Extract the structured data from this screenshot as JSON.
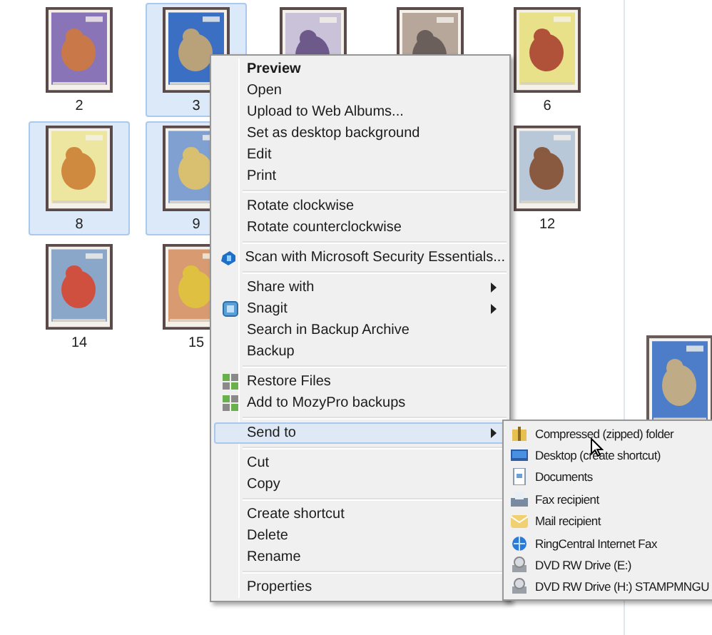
{
  "thumbnails": [
    {
      "kind": "stamp",
      "label": "2",
      "selected": false
    },
    {
      "kind": "stamp",
      "label": "3",
      "selected": true
    },
    {
      "kind": "partial"
    },
    {
      "kind": "partial"
    },
    {
      "kind": "stamp",
      "label": "6",
      "selected": false
    },
    {
      "kind": "stamp",
      "label": "8",
      "selected": true
    },
    {
      "kind": "stamp",
      "label": "9",
      "selected": true
    },
    {
      "kind": "covered"
    },
    {
      "kind": "covered"
    },
    {
      "kind": "stamp",
      "label": "12",
      "selected": false
    },
    {
      "kind": "stamp",
      "label": "14",
      "selected": false
    },
    {
      "kind": "stamp",
      "label": "15",
      "selected": false
    }
  ],
  "context_menu": {
    "groups": [
      [
        {
          "label": "Preview",
          "default": true,
          "submenu": false,
          "selected": false
        },
        {
          "label": "Open",
          "default": false,
          "submenu": false,
          "selected": false
        },
        {
          "label": "Upload to Web Albums...",
          "default": false,
          "submenu": false,
          "selected": false
        },
        {
          "label": "Set as desktop background",
          "default": false,
          "submenu": false,
          "selected": false
        },
        {
          "label": "Edit",
          "default": false,
          "submenu": false,
          "selected": false
        },
        {
          "label": "Print",
          "default": false,
          "submenu": false,
          "selected": false
        }
      ],
      [
        {
          "label": "Rotate clockwise",
          "default": false,
          "submenu": false,
          "selected": false
        },
        {
          "label": "Rotate counterclockwise",
          "default": false,
          "submenu": false,
          "selected": false
        }
      ],
      [
        {
          "label": "Scan with Microsoft Security Essentials...",
          "default": false,
          "submenu": false,
          "selected": false
        }
      ],
      [
        {
          "label": "Share with",
          "default": false,
          "submenu": true,
          "selected": false
        },
        {
          "label": "Snagit",
          "default": false,
          "submenu": true,
          "selected": false
        },
        {
          "label": "Search in Backup Archive",
          "default": false,
          "submenu": false,
          "selected": false
        },
        {
          "label": "Backup",
          "default": false,
          "submenu": false,
          "selected": false
        }
      ],
      [
        {
          "label": "Restore Files",
          "default": false,
          "submenu": false,
          "selected": false
        },
        {
          "label": "Add to MozyPro backups",
          "default": false,
          "submenu": false,
          "selected": false
        }
      ],
      [
        {
          "label": "Send to",
          "default": false,
          "submenu": true,
          "selected": true
        }
      ],
      [
        {
          "label": "Cut",
          "default": false,
          "submenu": false,
          "selected": false
        },
        {
          "label": "Copy",
          "default": false,
          "submenu": false,
          "selected": false
        }
      ],
      [
        {
          "label": "Create shortcut",
          "default": false,
          "submenu": false,
          "selected": false
        },
        {
          "label": "Delete",
          "default": false,
          "submenu": false,
          "selected": false
        },
        {
          "label": "Rename",
          "default": false,
          "submenu": false,
          "selected": false
        }
      ],
      [
        {
          "label": "Properties",
          "default": false,
          "submenu": false,
          "selected": false
        }
      ]
    ]
  },
  "send_to_menu": {
    "items": [
      {
        "label": "Compressed (zipped) folder",
        "selected": false
      },
      {
        "label": "Desktop (create shortcut)",
        "selected": false
      },
      {
        "label": "Documents",
        "selected": false
      },
      {
        "label": "Fax recipient",
        "selected": false
      },
      {
        "label": "Mail recipient",
        "selected": false
      },
      {
        "label": "RingCentral Internet Fax",
        "selected": false
      },
      {
        "label": "DVD RW Drive (E:)",
        "selected": false
      },
      {
        "label": "DVD RW Drive (H:) STAMPMNGU",
        "selected": false
      }
    ]
  }
}
